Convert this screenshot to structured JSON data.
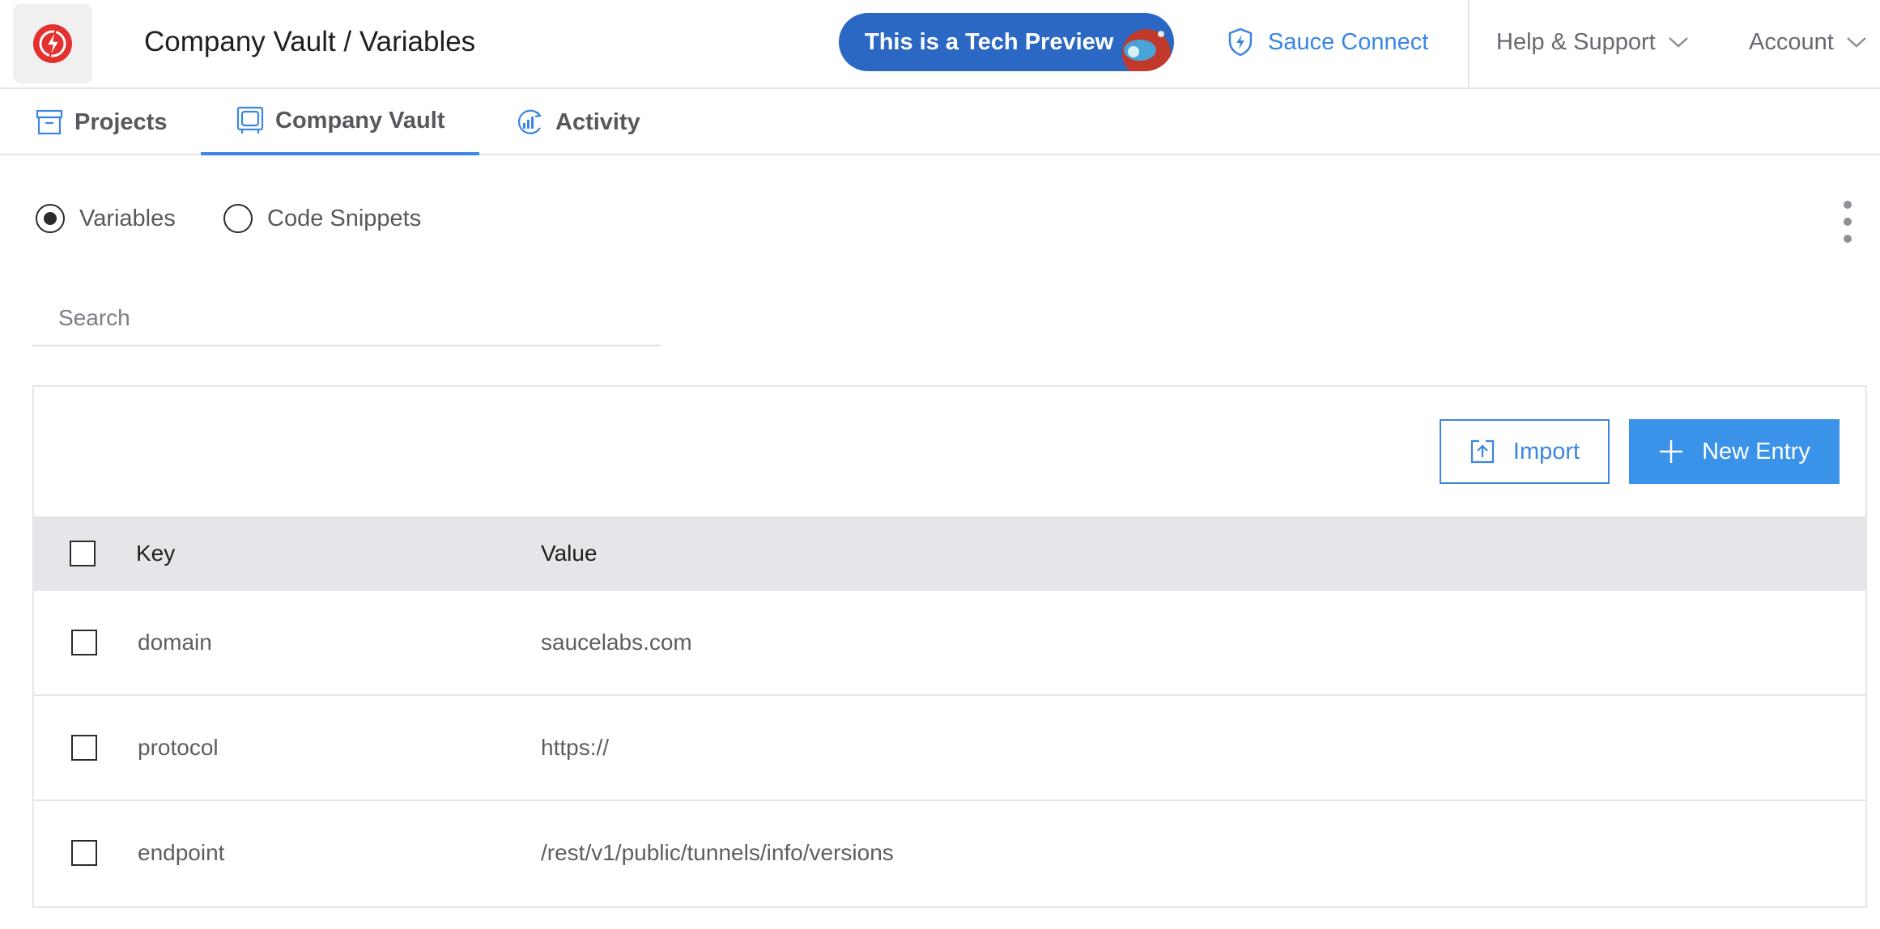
{
  "header": {
    "title": "Company Vault / Variables",
    "preview_badge": "This is a Tech Preview",
    "sauce_connect": "Sauce Connect",
    "help_menu": "Help & Support",
    "account_menu": "Account"
  },
  "tabs": [
    {
      "label": "Projects",
      "icon": "archive-icon",
      "active": false
    },
    {
      "label": "Company Vault",
      "icon": "vault-icon",
      "active": true
    },
    {
      "label": "Activity",
      "icon": "activity-chart-icon",
      "active": false
    }
  ],
  "view_toggle": {
    "options": [
      "Variables",
      "Code Snippets"
    ],
    "selected": "Variables"
  },
  "search": {
    "placeholder": "Search",
    "value": ""
  },
  "toolbar": {
    "import_label": "Import",
    "new_entry_label": "New Entry"
  },
  "table": {
    "columns": [
      "Key",
      "Value"
    ],
    "rows": [
      {
        "key": "domain",
        "value": "saucelabs.com",
        "checked": false
      },
      {
        "key": "protocol",
        "value": "https://",
        "checked": false
      },
      {
        "key": "endpoint",
        "value": "/rest/v1/public/tunnels/info/versions",
        "checked": false
      }
    ]
  },
  "colors": {
    "accent": "#3a86e2",
    "badge_bg": "#2b68c3",
    "primary_button": "#3a93e8",
    "logo_red": "#e2312e",
    "header_row_bg": "#e5e6e9"
  }
}
